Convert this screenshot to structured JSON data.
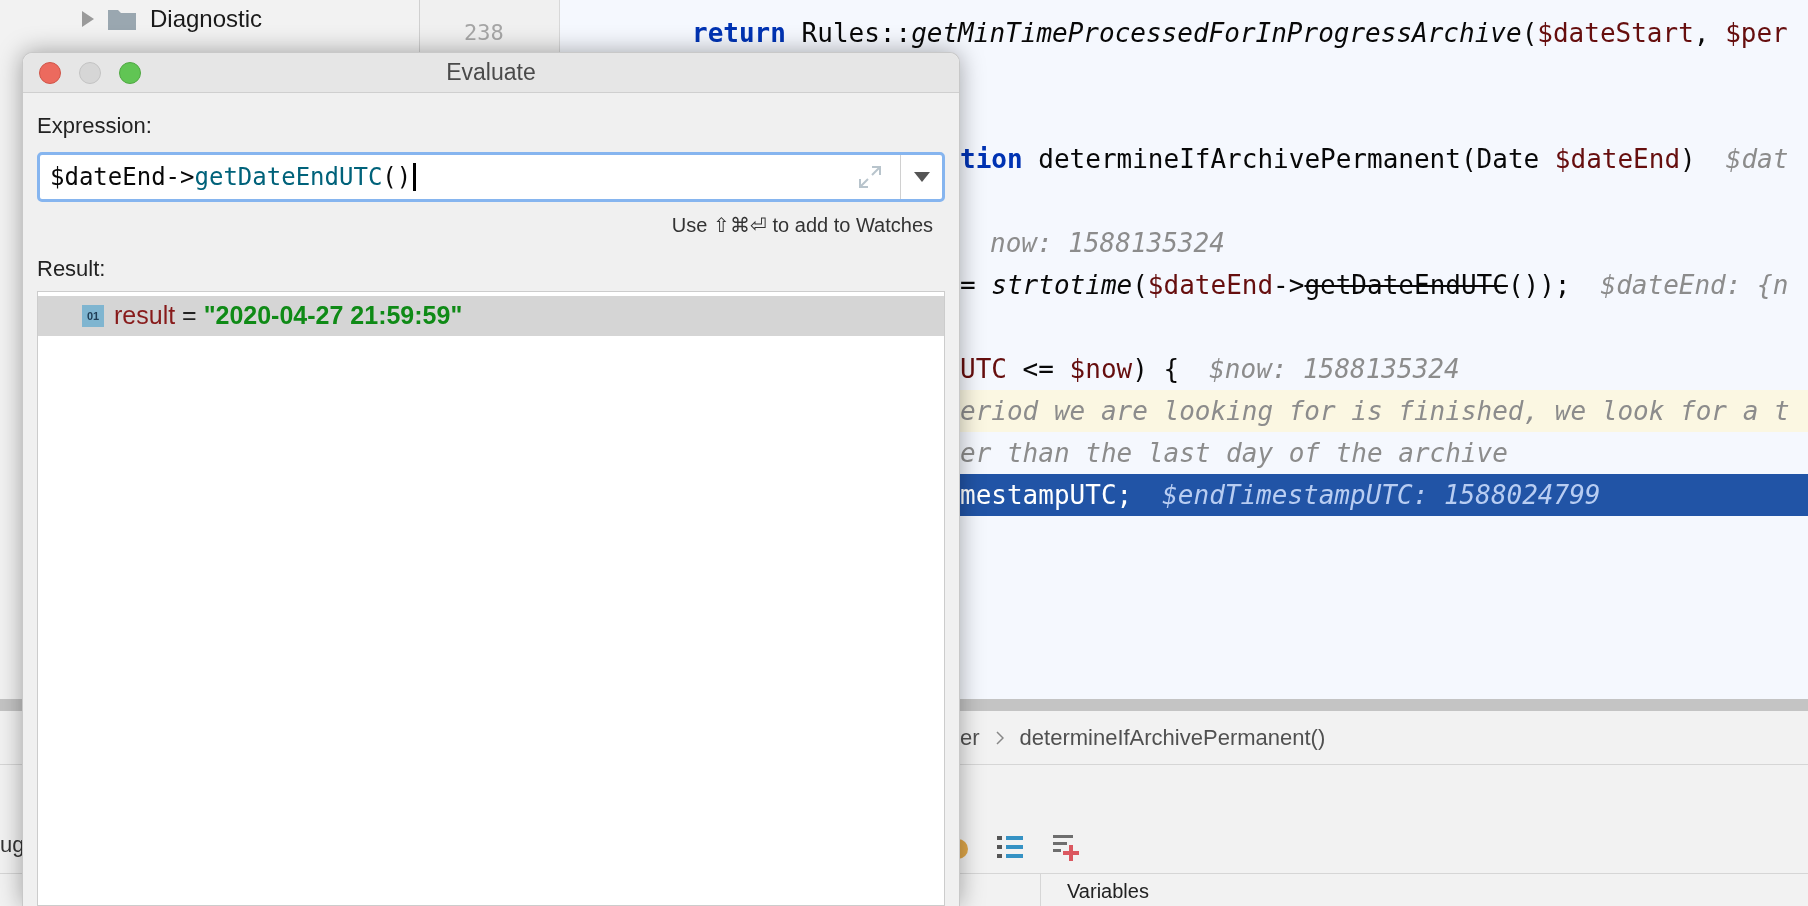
{
  "project_tree": {
    "items": [
      {
        "label": "Diagnostic",
        "expanded": false
      }
    ]
  },
  "gutter": {
    "line_numbers": [
      "238"
    ]
  },
  "side_fragment": "ug",
  "editor": {
    "lines": [
      {
        "kind": "blank"
      },
      {
        "kind": "full",
        "segments": [
          {
            "t": "return",
            "kind": "keyword"
          },
          {
            "t": " Rules::",
            "kind": "plain"
          },
          {
            "t": "getMinTimeProcessedForInProgressArchive",
            "kind": "italic"
          },
          {
            "t": "(",
            "kind": "plain"
          },
          {
            "t": "$dateStart",
            "kind": "variable"
          },
          {
            "t": ", ",
            "kind": "plain"
          },
          {
            "t": "$per",
            "kind": "variable"
          }
        ]
      },
      {
        "kind": "blank"
      },
      {
        "kind": "blank"
      },
      {
        "kind": "clipped",
        "segments": [
          {
            "t": "tion",
            "kind": "keyword"
          },
          {
            "t": " determineIfArchivePermanent(Date ",
            "kind": "plain"
          },
          {
            "t": "$dateEnd",
            "kind": "variable"
          },
          {
            "t": ")",
            "kind": "plain"
          },
          {
            "t": "$dat",
            "kind": "hint"
          }
        ]
      },
      {
        "kind": "blank"
      },
      {
        "kind": "clipped",
        "segments": [
          {
            "t": "now: 1588135324",
            "kind": "hint"
          }
        ]
      },
      {
        "kind": "clipped",
        "segments": [
          {
            "t": "= ",
            "kind": "plain"
          },
          {
            "t": "strtotime",
            "kind": "italic"
          },
          {
            "t": "(",
            "kind": "plain"
          },
          {
            "t": "$dateEnd",
            "kind": "variable"
          },
          {
            "t": "->",
            "kind": "plain"
          },
          {
            "t": "getDateEndUTC",
            "kind": "struck"
          },
          {
            "t": "());",
            "kind": "plain"
          },
          {
            "t": "$dateEnd: {n",
            "kind": "hint"
          }
        ]
      },
      {
        "kind": "blank"
      },
      {
        "kind": "clipped",
        "segments": [
          {
            "t": "UTC",
            "kind": "variable"
          },
          {
            "t": " <= ",
            "kind": "plain"
          },
          {
            "t": "$now",
            "kind": "variable"
          },
          {
            "t": ") {",
            "kind": "plain"
          },
          {
            "t": "$now: 1588135324",
            "kind": "hint"
          }
        ]
      },
      {
        "kind": "clipped-warning",
        "segments": [
          {
            "t": "eriod we are looking for is finished, we look for a t",
            "kind": "comment"
          }
        ]
      },
      {
        "kind": "clipped",
        "segments": [
          {
            "t": "er than the last day of the archive",
            "kind": "comment"
          }
        ]
      },
      {
        "kind": "clipped-execution",
        "segments": [
          {
            "t": "mestampUTC;",
            "kind": "plain"
          },
          {
            "t": "$endTimestampUTC: 1588024799",
            "kind": "hint"
          }
        ]
      }
    ]
  },
  "breadcrumbs": [
    "er",
    "determineIfArchivePermanent()"
  ],
  "debug_tab": "Variables",
  "dialog": {
    "title": "Evaluate",
    "expression_label": "Expression:",
    "expression": [
      {
        "t": "$dateEnd->",
        "kind": "plain"
      },
      {
        "t": "getDateEndUTC",
        "kind": "method"
      },
      {
        "t": "()",
        "kind": "plain"
      }
    ],
    "hint": "Use ⇧⌘⏎ to add to Watches",
    "result_label": "Result:",
    "results": [
      {
        "badge": "01",
        "name": "result",
        "operator": "=",
        "value": "\"2020-04-27 21:59:59\"",
        "selected": true
      }
    ]
  }
}
